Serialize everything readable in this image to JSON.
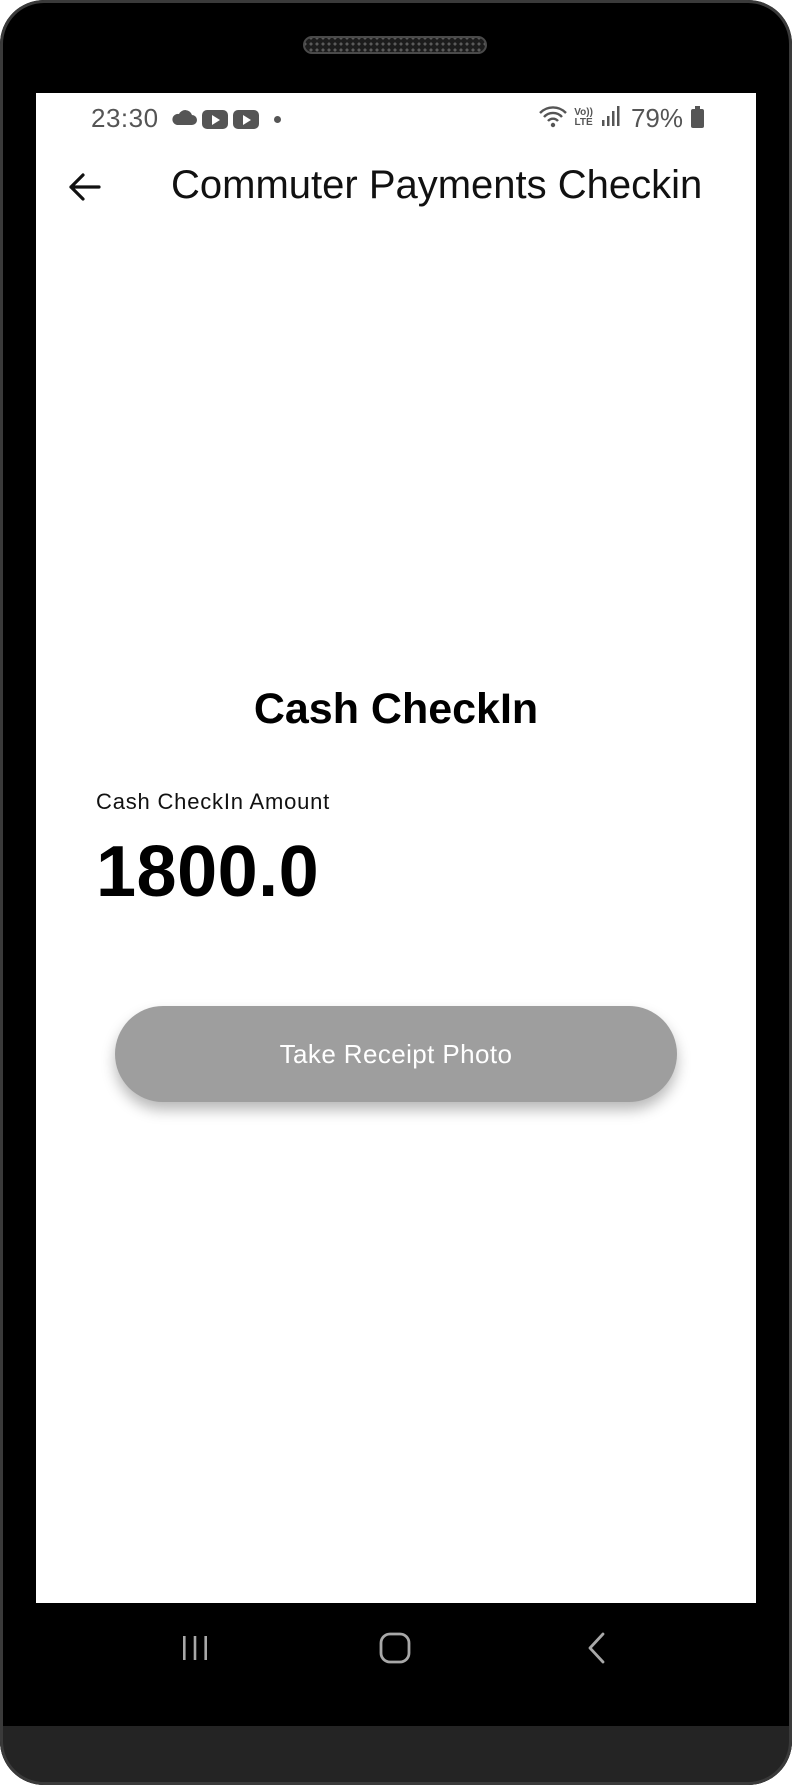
{
  "status_bar": {
    "time": "23:30",
    "network_label_top": "Vo))",
    "network_label_bottom": "LTE",
    "battery": "79%"
  },
  "app_bar": {
    "title": "Commuter Payments Checkin"
  },
  "content": {
    "heading": "Cash CheckIn",
    "amount_label": "Cash CheckIn Amount",
    "amount_value": "1800.0",
    "photo_button_label": "Take Receipt Photo"
  },
  "colors": {
    "button_background": "#9e9e9e",
    "button_text": "#ffffff",
    "status_icons": "#555555"
  },
  "icons": {
    "back": "arrow-left-icon",
    "status": [
      "cloud-icon",
      "youtube-icon",
      "youtube-icon",
      "notification-dot-icon",
      "wifi-icon",
      "signal-icon",
      "battery-icon"
    ],
    "nav": [
      "recents-icon",
      "home-icon",
      "back-chevron-icon"
    ]
  }
}
